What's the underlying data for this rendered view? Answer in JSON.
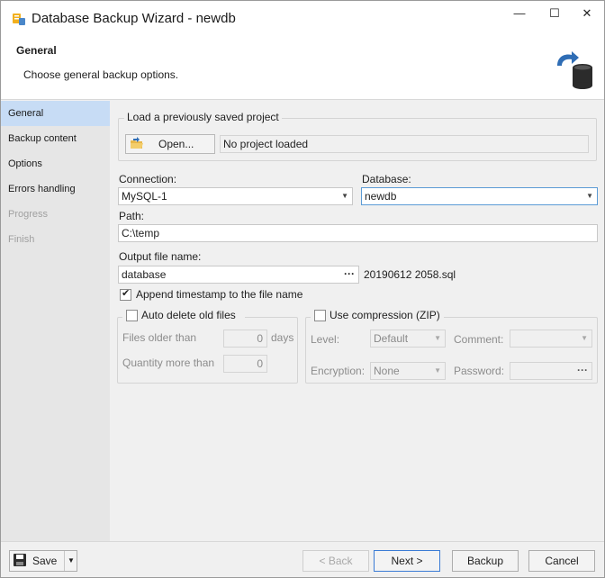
{
  "window": {
    "title": "Database Backup Wizard - newdb",
    "minimize": "—",
    "maximize": "☐",
    "close": "✕"
  },
  "header": {
    "title": "General",
    "subtitle": "Choose general backup options."
  },
  "sidebar": {
    "items": [
      {
        "label": "General",
        "state": "active"
      },
      {
        "label": "Backup content",
        "state": "normal"
      },
      {
        "label": "Options",
        "state": "normal"
      },
      {
        "label": "Errors handling",
        "state": "normal"
      },
      {
        "label": "Progress",
        "state": "disabled"
      },
      {
        "label": "Finish",
        "state": "disabled"
      }
    ]
  },
  "project": {
    "group_label": "Load a previously saved project",
    "open_label": "Open...",
    "status": "No project loaded"
  },
  "connection": {
    "label": "Connection:",
    "value": "MySQL-1"
  },
  "database": {
    "label": "Database:",
    "value": "newdb"
  },
  "path": {
    "label": "Path:",
    "value": "C:\\temp"
  },
  "output": {
    "label": "Output file name:",
    "value": "database",
    "browse": "···",
    "suffix": "20190612 2058.sql"
  },
  "append_timestamp": {
    "label": "Append timestamp to the file name",
    "checked": true
  },
  "auto_delete": {
    "label": "Auto delete old files",
    "checked": false,
    "files_older_label": "Files older than",
    "files_older_value": "0",
    "files_older_unit": "days",
    "quantity_label": "Quantity more than",
    "quantity_value": "0"
  },
  "compression": {
    "label": "Use compression (ZIP)",
    "checked": false,
    "level_label": "Level:",
    "level_value": "Default",
    "comment_label": "Comment:",
    "comment_value": "",
    "encryption_label": "Encryption:",
    "encryption_value": "None",
    "password_label": "Password:",
    "password_value": "",
    "password_browse": "···"
  },
  "footer": {
    "save_label": "Save",
    "back_label": "< Back",
    "next_label": "Next >",
    "backup_label": "Backup",
    "cancel_label": "Cancel"
  },
  "colors": {
    "accent": "#3a7bd5",
    "active_nav": "#c7dcf5",
    "sidebar_bg": "#e6e6e6"
  }
}
